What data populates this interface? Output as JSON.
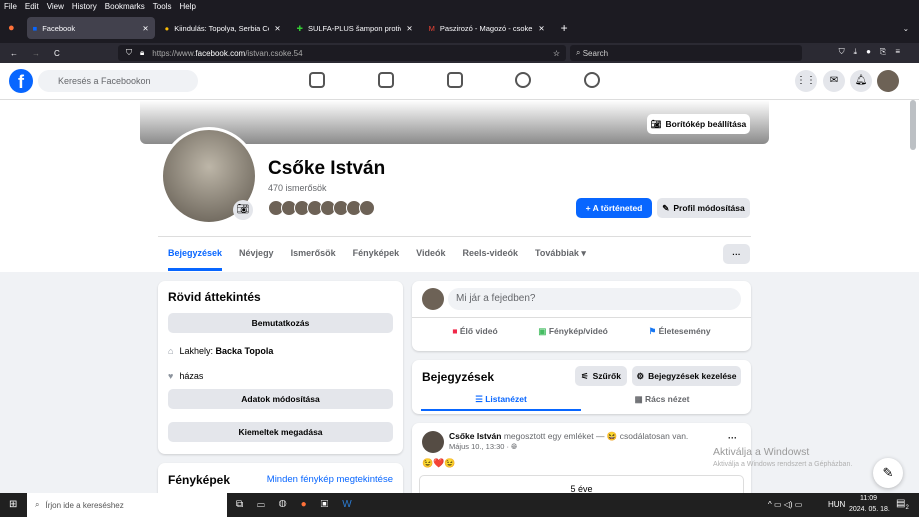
{
  "menubar": [
    "File",
    "Edit",
    "View",
    "History",
    "Bookmarks",
    "Tools",
    "Help"
  ],
  "tabs": [
    {
      "title": "Facebook",
      "icon": "facebook-icon"
    },
    {
      "title": "Kiindulás: Topolya, Serbia Cél: F",
      "icon": "maps-pin-icon"
    },
    {
      "title": "SULFA-PLUS šampon protiv per",
      "icon": "cross-icon"
    },
    {
      "title": "Paszirozó - Magozó - csoke.istv",
      "icon": "gmail-icon"
    }
  ],
  "url": {
    "prefix": "https://www.",
    "domain": "facebook.com",
    "path": "/istvan.csoke.54"
  },
  "browser_search": "Search",
  "fb": {
    "search_placeholder": "Keresés a Facebookon"
  },
  "profile": {
    "cover_button": "Borítókép beállítása",
    "name": "Csőke István",
    "friends": "470 ismerősök",
    "story_button": "+ A történeted",
    "edit_button": "Profil módosítása",
    "more": "···",
    "tabs": [
      "Bejegyzések",
      "Névjegy",
      "Ismerősök",
      "Fényképek",
      "Videók",
      "Reels-videók",
      "Továbbiak ▾"
    ]
  },
  "intro": {
    "title": "Rövid áttekintés",
    "bio_button": "Bemutatkozás",
    "lives_prefix": "Lakhely: ",
    "lives": "Backa Topola",
    "status": "házas",
    "edit_details": "Adatok módosítása",
    "featured": "Kiemeltek megadása"
  },
  "photos": {
    "title": "Fényképek",
    "see_all": "Minden fénykép megtekintése"
  },
  "composer": {
    "placeholder": "Mi jár a fejedben?",
    "live": "Élő videó",
    "photo": "Fénykép/videó",
    "event": "Életesemény"
  },
  "posts": {
    "title": "Bejegyzések",
    "filter": "Szűrők",
    "manage": "Bejegyzések kezelése",
    "list_view": "Listanézet",
    "grid_view": "Rács nézet"
  },
  "post": {
    "author": "Csőke István",
    "action": "megosztott egy emléket — 😆 csodálatosan van.",
    "time": "Május 10., 13:30 ·",
    "emojis": "😉❤️😉",
    "memory": "5 éve",
    "more": "···"
  },
  "watermark": {
    "title": "Aktiválja a Windowst",
    "sub": "Aktiválja a Windows rendszert a Gépházban."
  },
  "taskbar": {
    "search": "Írjon ide a kereséshez",
    "lang": "HUN",
    "time": "11:09",
    "date": "2024. 05. 18.",
    "notif": "2"
  }
}
